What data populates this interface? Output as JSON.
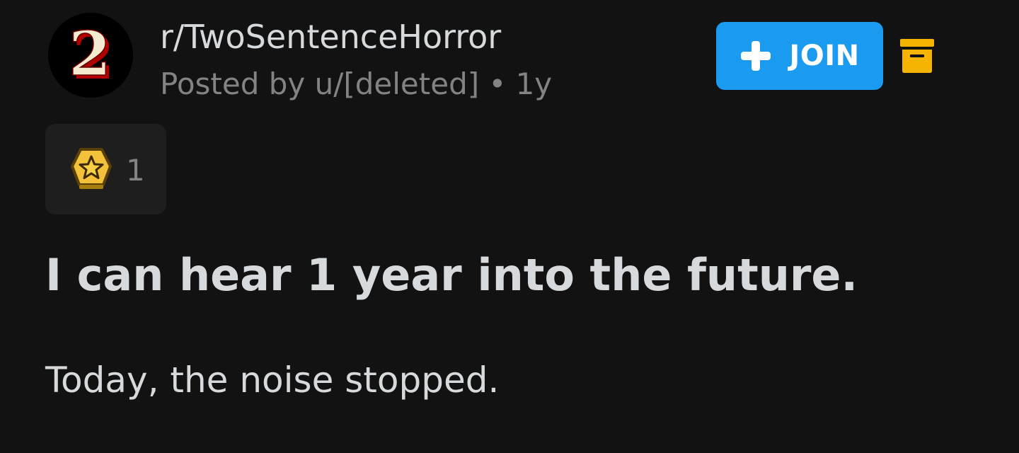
{
  "post_header": {
    "subreddit": "r/TwoSentenceHorror",
    "posted_by": "Posted by u/[deleted] • 1y",
    "avatar_glyph": "2",
    "avatar_icon": "subreddit-avatar-icon"
  },
  "actions": {
    "join_label": "JOIN",
    "join_icon": "plus-icon",
    "archive_icon": "archive-icon"
  },
  "awards": {
    "icon": "star-award-icon",
    "count": "1"
  },
  "post": {
    "title": "I can hear 1 year into the future.",
    "body": "Today, the noise stopped."
  },
  "colors": {
    "background": "#121212",
    "primary_text": "#d7dadc",
    "secondary_text": "#818384",
    "join_button": "#1a9bf0",
    "archive_icon": "#f5b400",
    "award_box": "#1e1e1f",
    "award_gold": "#f3c23a"
  }
}
